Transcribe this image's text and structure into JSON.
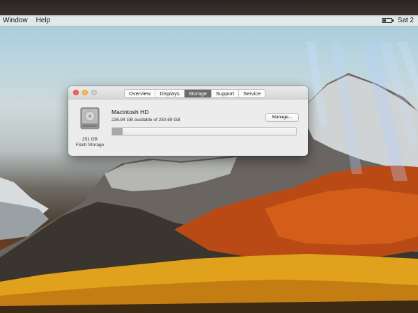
{
  "menubar": {
    "items": [
      "Window",
      "Help"
    ],
    "clock": "Sat 2"
  },
  "window": {
    "tabs": [
      {
        "label": "Overview",
        "active": false
      },
      {
        "label": "Displays",
        "active": false
      },
      {
        "label": "Storage",
        "active": true
      },
      {
        "label": "Support",
        "active": false
      },
      {
        "label": "Service",
        "active": false
      }
    ],
    "drive": {
      "name": "Macintosh HD",
      "availability": "236.84 GB available of 250.69 GB",
      "capacity": "251 GB",
      "type": "Flash Storage",
      "used_fraction": 0.055
    },
    "manage_label": "Manage..."
  },
  "colors": {
    "close": "#fc605c",
    "minimize": "#fdbc40",
    "zoom": "#cfcfcf",
    "active_tab": "#6c6c6c"
  }
}
